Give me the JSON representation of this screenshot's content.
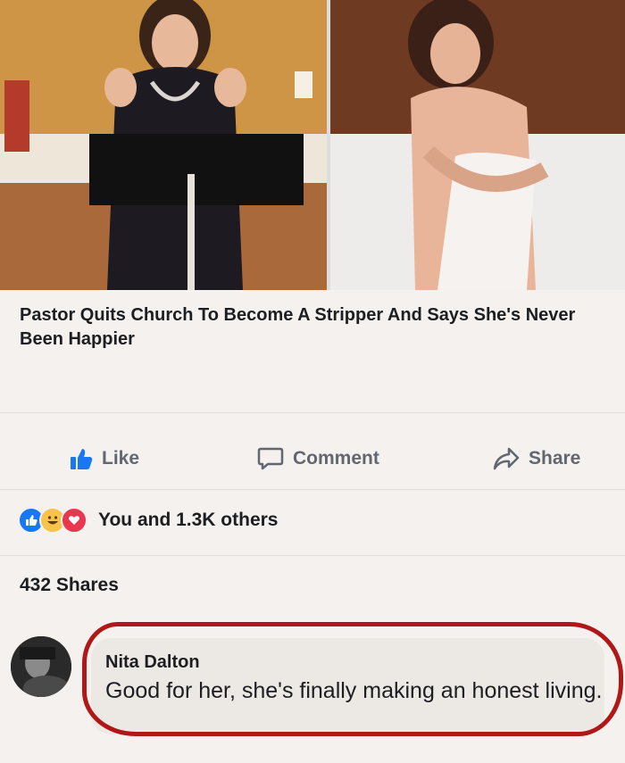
{
  "post": {
    "headline": "Pastor Quits Church To Become A Stripper And Says She's Never Been Happier"
  },
  "actions": {
    "like_label": "Like",
    "comment_label": "Comment",
    "share_label": "Share"
  },
  "reactions": {
    "icons": [
      "like-reaction",
      "haha-reaction",
      "love-reaction"
    ],
    "summary": "You and 1.3K others"
  },
  "shares": {
    "count_text": "432 Shares"
  },
  "comment": {
    "author": "Nita Dalton",
    "text": "Good for her, she's finally making an honest living."
  },
  "colors": {
    "like_blue": "#1877f2",
    "highlight_red": "#b01818"
  }
}
